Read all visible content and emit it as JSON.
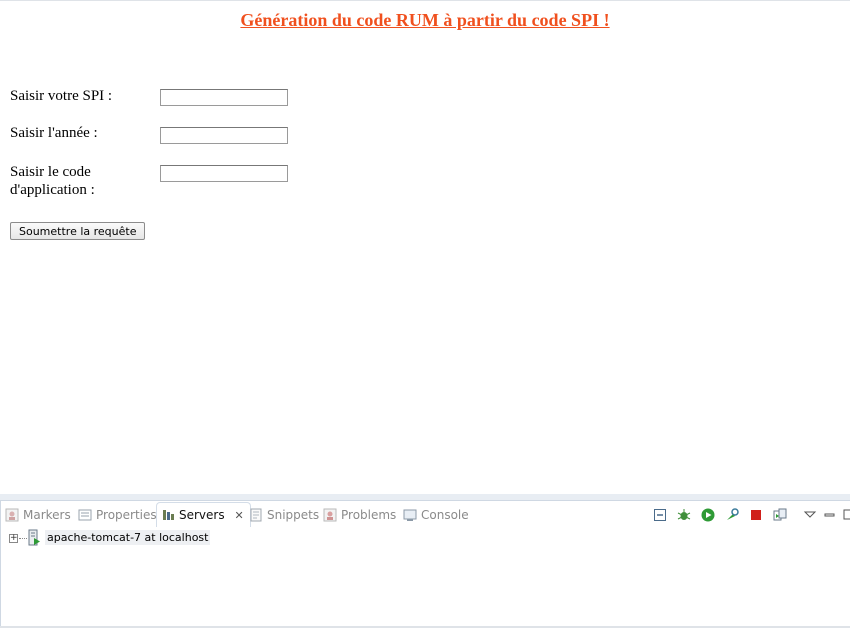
{
  "form": {
    "title": "Génération du code RUM à partir du code SPI !",
    "spi_label": "Saisir votre SPI :",
    "annee_label": "Saisir l'année :",
    "code_label": "Saisir le code d'application :",
    "spi_value": "",
    "annee_value": "",
    "code_value": "",
    "submit_label": "Soumettre la requête"
  },
  "panel": {
    "tabs": [
      {
        "label": "Markers",
        "icon": "markers-icon",
        "active": false
      },
      {
        "label": "Properties",
        "icon": "properties-icon",
        "active": false
      },
      {
        "label": "Servers",
        "icon": "servers-icon",
        "active": true
      },
      {
        "label": "Snippets",
        "icon": "snippets-icon",
        "active": false
      },
      {
        "label": "Problems",
        "icon": "problems-icon",
        "active": false
      },
      {
        "label": "Console",
        "icon": "console-icon",
        "active": false
      }
    ],
    "toolbar_icons": [
      "collapse-all-icon",
      "debug-server-icon",
      "start-server-icon",
      "profile-server-icon",
      "stop-server-icon",
      "publish-icon",
      "view-menu-icon",
      "minimize-icon",
      "maximize-icon"
    ],
    "server": {
      "label": "apache-tomcat-7 at localhost"
    }
  },
  "colors": {
    "title": "#f0501e",
    "accent_green": "#2e9a35",
    "stop_red": "#d0201b"
  }
}
